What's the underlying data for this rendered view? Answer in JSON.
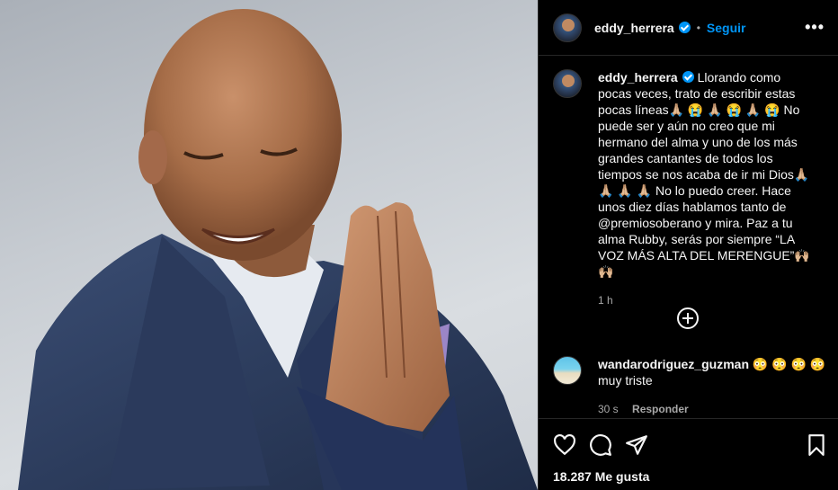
{
  "post": {
    "username": "eddy_herrera",
    "follow_label": "Seguir",
    "separator": "•",
    "more_label": "•••"
  },
  "caption": {
    "username": "eddy_herrera",
    "text": "Llorando como pocas veces, trato de escribir estas pocas líneas🙏🏼 😭 🙏🏼 😭 🙏🏼 😭  No puede ser y aún no creo que mi hermano del alma y uno de los más grandes cantantes de todos los tiempos se nos acaba de ir mi Dios🙏🏼 🙏🏼 🙏🏼 🙏🏼  No lo puedo creer. Hace unos diez días hablamos tanto de @premiosoberano y mira. Paz a tu alma Rubby, serás por siempre “LA VOZ MÁS ALTA DEL MERENGUE”🙌🏼 🙌🏼",
    "time": "1 h"
  },
  "comments": [
    {
      "username": "wandarodriguez_guzman",
      "text_line1": "😳 😳 😳 😳",
      "text_line2": "muy triste",
      "time": "30 s",
      "reply_label": "Responder"
    }
  ],
  "actions": {
    "likes": "18.287 Me gusta"
  },
  "colors": {
    "accent": "#0095f6",
    "background": "#000000",
    "text": "#f5f5f5",
    "muted": "#a8a8a8"
  }
}
